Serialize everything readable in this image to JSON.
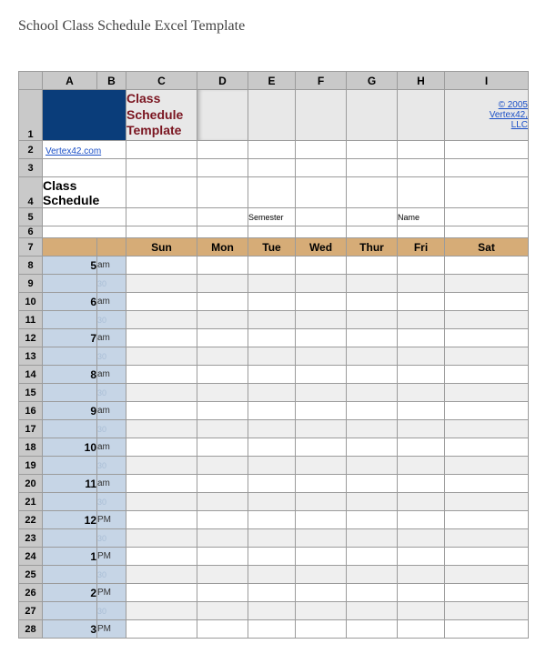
{
  "page_title": "School Class Schedule Excel Template",
  "col_headers": [
    "A",
    "B",
    "C",
    "D",
    "E",
    "F",
    "G",
    "H",
    "I"
  ],
  "row1": {
    "num": "1",
    "class_schedule_template": "Class Schedule Template",
    "copyright_line1": "© 2005",
    "copyright_line2": "Vertex42,",
    "copyright_line3": "LLC"
  },
  "row2": {
    "num": "2",
    "link": "Vertex42.com"
  },
  "row3": {
    "num": "3"
  },
  "row4": {
    "num": "4",
    "label": "Class Schedule"
  },
  "row5": {
    "num": "5",
    "semester": "Semester",
    "name": "Name"
  },
  "row6": {
    "num": "6"
  },
  "row7": {
    "num": "7",
    "days": [
      "Sun",
      "Mon",
      "Tue",
      "Wed",
      "Thur",
      "Fri",
      "Sat"
    ]
  },
  "time_rows": [
    {
      "num": "8",
      "hour": "5",
      "suffix": "am",
      "half": false
    },
    {
      "num": "9",
      "hour": "",
      "suffix": "30",
      "half": true
    },
    {
      "num": "10",
      "hour": "6",
      "suffix": "am",
      "half": false
    },
    {
      "num": "11",
      "hour": "",
      "suffix": "30",
      "half": true
    },
    {
      "num": "12",
      "hour": "7",
      "suffix": "am",
      "half": false
    },
    {
      "num": "13",
      "hour": "",
      "suffix": "30",
      "half": true
    },
    {
      "num": "14",
      "hour": "8",
      "suffix": "am",
      "half": false
    },
    {
      "num": "15",
      "hour": "",
      "suffix": "30",
      "half": true
    },
    {
      "num": "16",
      "hour": "9",
      "suffix": "am",
      "half": false
    },
    {
      "num": "17",
      "hour": "",
      "suffix": "30",
      "half": true
    },
    {
      "num": "18",
      "hour": "10",
      "suffix": "am",
      "half": false
    },
    {
      "num": "19",
      "hour": "",
      "suffix": "30",
      "half": true
    },
    {
      "num": "20",
      "hour": "11",
      "suffix": "am",
      "half": false
    },
    {
      "num": "21",
      "hour": "",
      "suffix": "30",
      "half": true
    },
    {
      "num": "22",
      "hour": "12",
      "suffix": "PM",
      "half": false
    },
    {
      "num": "23",
      "hour": "",
      "suffix": "30",
      "half": true
    },
    {
      "num": "24",
      "hour": "1",
      "suffix": "PM",
      "half": false
    },
    {
      "num": "25",
      "hour": "",
      "suffix": "30",
      "half": true
    },
    {
      "num": "26",
      "hour": "2",
      "suffix": "PM",
      "half": false
    },
    {
      "num": "27",
      "hour": "",
      "suffix": "30",
      "half": true
    },
    {
      "num": "28",
      "hour": "3",
      "suffix": "PM",
      "half": false
    }
  ]
}
